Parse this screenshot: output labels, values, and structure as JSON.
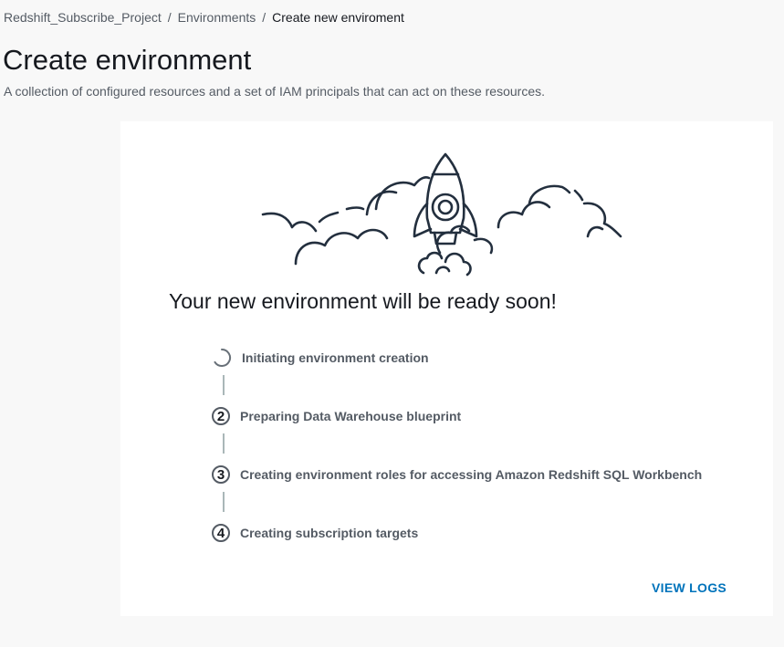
{
  "breadcrumb": {
    "project": "Redshift_Subscribe_Project",
    "environments": "Environments",
    "current": "Create new enviroment",
    "separator": "/"
  },
  "header": {
    "title": "Create environment",
    "description": "A collection of configured resources and a set of IAM principals that can act on these resources."
  },
  "card": {
    "illustration_icon": "rocket-launch-icon",
    "headline": "Your new environment will be ready soon!",
    "steps": [
      {
        "status": "in-progress",
        "label": "Initiating environment creation"
      },
      {
        "number": "2",
        "label": "Preparing Data Warehouse blueprint"
      },
      {
        "number": "3",
        "label": "Creating environment roles for accessing Amazon Redshift SQL Workbench"
      },
      {
        "number": "4",
        "label": "Creating subscription targets"
      }
    ],
    "view_logs_label": "VIEW LOGS"
  },
  "colors": {
    "page_background": "#f8f8f8",
    "card_background": "#ffffff",
    "link": "#0073bb",
    "text": "#16191f",
    "muted_text": "#545b64"
  }
}
